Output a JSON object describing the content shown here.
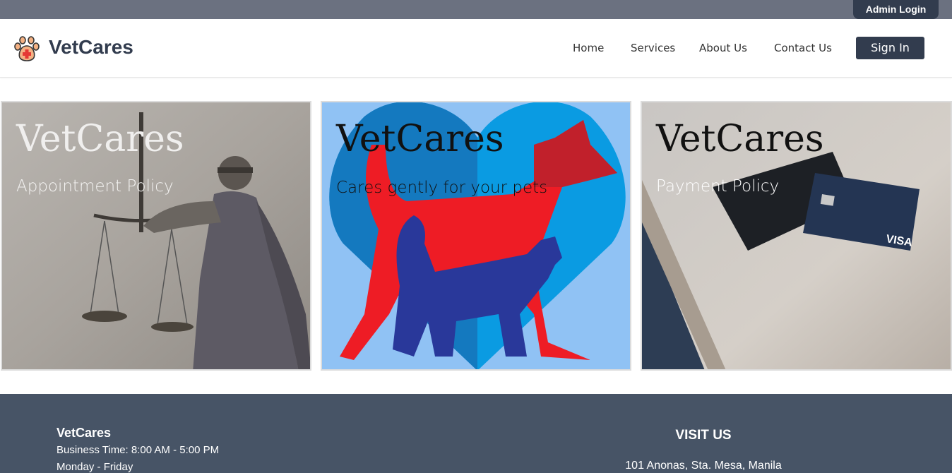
{
  "topbar": {
    "admin_label": "Admin Login"
  },
  "navbar": {
    "brand": "VetCares",
    "logo_icon": "paw-cross-icon",
    "links": [
      "Home",
      "Services",
      "About Us",
      "Contact Us"
    ],
    "signin_label": "Sign In"
  },
  "cards": [
    {
      "title": "VetCares",
      "subtitle": "Appointment Policy",
      "image": "lady-justice-statue"
    },
    {
      "title": "VetCares",
      "subtitle": "Cares gently for your pets",
      "image": "dog-cat-heart"
    },
    {
      "title": "VetCares",
      "subtitle": "Payment Policy",
      "image": "credit-card-on-table"
    }
  ],
  "footer": {
    "brand": "VetCares",
    "business_time": "Business Time: 8:00 AM - 5:00 PM",
    "days": "Monday - Friday",
    "visit_heading": "VISIT US",
    "address": "101 Anonas, Sta. Mesa, Manila"
  },
  "colors": {
    "topbar": "#6b7180",
    "dark": "#323c4e",
    "footer": "#475466"
  }
}
